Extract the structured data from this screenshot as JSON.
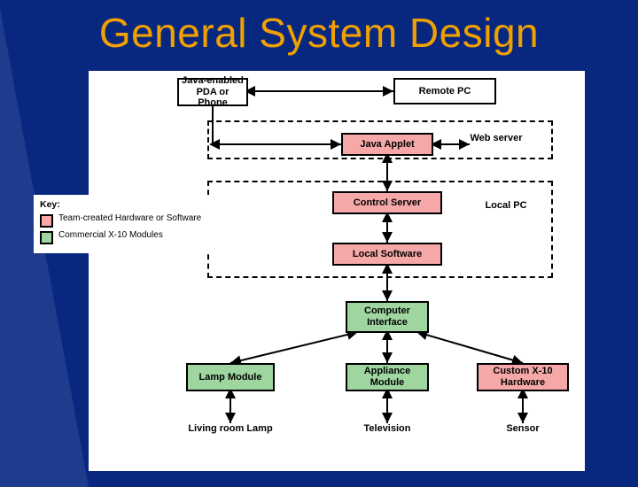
{
  "title": "General System Design",
  "groups": {
    "remote_pc": "Remote PC",
    "local_pc": "Local PC"
  },
  "boxes": {
    "java_device": "Java-enabled PDA or Phone",
    "java_applet": "Java Applet",
    "web_server": "Web server",
    "control_server": "Control Server",
    "local_software": "Local Software",
    "computer_interface": "Computer Interface",
    "lamp_module": "Lamp Module",
    "appliance_module": "Appliance Module",
    "custom_x10": "Custom X-10 Hardware",
    "living_room_lamp": "Living room Lamp",
    "television": "Television",
    "sensor": "Sensor"
  },
  "key": {
    "heading": "Key:",
    "item_pink": "Team-created Hardware or Software",
    "item_green": "Commercial X-10 Modules"
  }
}
